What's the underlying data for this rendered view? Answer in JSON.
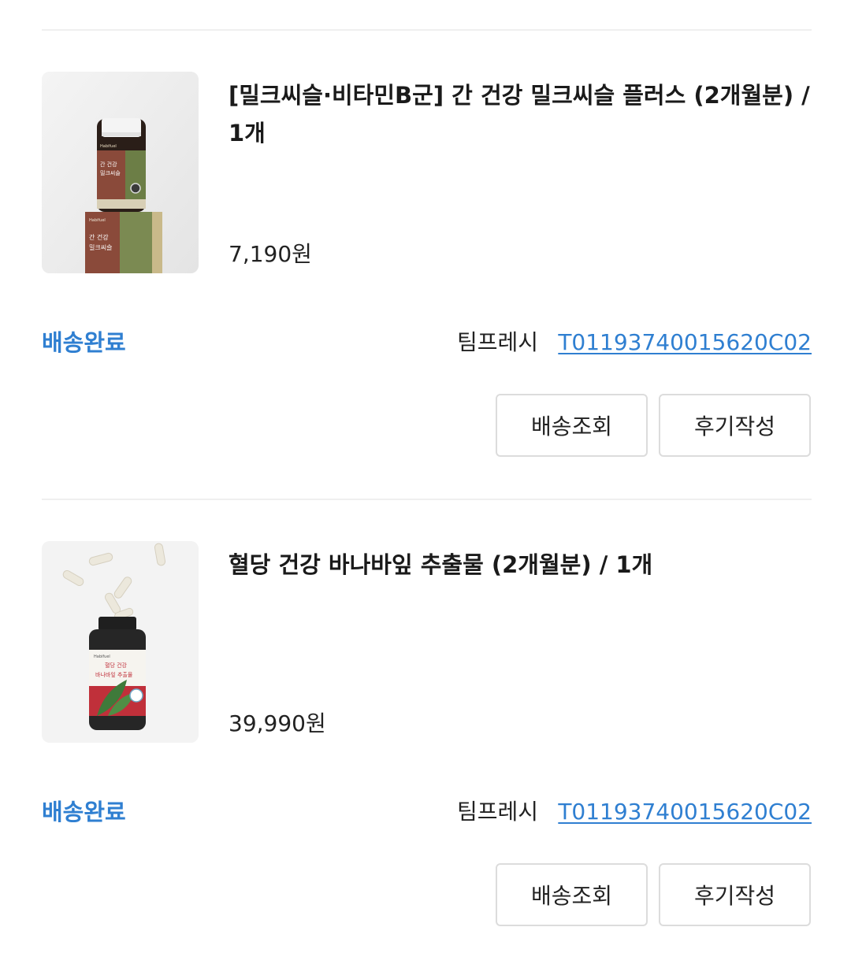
{
  "orders": [
    {
      "product_name": "[밀크씨슬·비타민B군] 간 건강 밀크씨슬 플러스 (2개월분) / 1개",
      "price": "7,190원",
      "status": "배송완료",
      "courier": "팀프레시",
      "tracking_number": "T01193740015620C02",
      "buttons": {
        "track": "배송조회",
        "review": "후기작성"
      },
      "image": {
        "brand": "Habifuel",
        "bottle_line1": "간 건강",
        "bottle_line2": "밀크씨슬",
        "box_line1": "간 건강",
        "box_line2": "밀크씨슬",
        "colors": {
          "label": "#8a4a3a",
          "box": "#7b8a52",
          "cap": "#f4f4f4"
        }
      }
    },
    {
      "product_name": "혈당 건강 바나바잎 추출물 (2개월분) / 1개",
      "price": "39,990원",
      "status": "배송완료",
      "courier": "팀프레시",
      "tracking_number": "T01193740015620C02",
      "buttons": {
        "track": "배송조회",
        "review": "후기작성"
      },
      "image": {
        "brand": "Habifuel",
        "label_line1": "혈당 건강",
        "label_line2": "바나바잎 추출물",
        "colors": {
          "label": "#c0303a",
          "leaf": "#3f7a3a",
          "bottle": "#2a2a2a"
        }
      }
    }
  ],
  "colors": {
    "accent_blue": "#2f7fd1",
    "divider": "#efefef",
    "button_border": "#dcdcdc"
  }
}
